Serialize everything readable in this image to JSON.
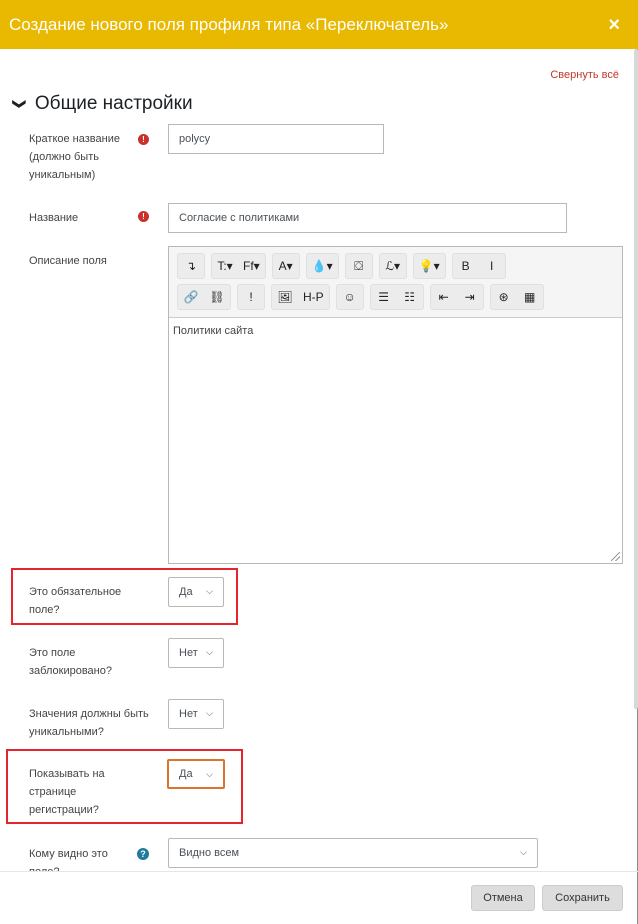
{
  "header": {
    "title": "Создание нового поля профиля типа «Переключатель»",
    "close_glyph": "×",
    "color": "#e8b900"
  },
  "collapse_all": "Свернуть всё",
  "section": {
    "chevron": "❯",
    "title": "Общие настройки"
  },
  "fields": {
    "shortname": {
      "label": "Краткое название (должно быть уникальным)",
      "value": "polycy",
      "required_icon": "!"
    },
    "name": {
      "label": "Название",
      "value": "Согласие с политиками",
      "required_icon": "!"
    },
    "description": {
      "label": "Описание поля",
      "content": "Политики сайта"
    },
    "required": {
      "label": "Это обязательное поле?",
      "value": "Да"
    },
    "locked": {
      "label": "Это поле заблокировано?",
      "value": "Нет"
    },
    "unique": {
      "label": "Значения должны быть уникальными?",
      "value": "Нет"
    },
    "signup": {
      "label": "Показывать на странице регистрации?",
      "value": "Да"
    },
    "visible": {
      "label": "Кому видно это поле?",
      "value": "Видно всем",
      "help_icon": "?"
    }
  },
  "toolbar": {
    "row1": [
      [
        "↴"
      ],
      [
        "T:▾",
        "Ff▾"
      ],
      [
        "A▾"
      ],
      [
        "💧▾"
      ],
      [
        "⛋"
      ],
      [
        "ℒ▾"
      ],
      [
        "💡▾"
      ],
      [
        "B",
        "I"
      ]
    ],
    "row2": [
      [
        "🔗",
        "⛓"
      ],
      [
        "!"
      ],
      [
        "🖼",
        "H-P"
      ],
      [
        "☺"
      ],
      [
        "☰",
        "☷"
      ],
      [
        "⇤",
        "⇥"
      ],
      [
        "⊛",
        "▦"
      ]
    ]
  },
  "buttons": {
    "cancel": "Отмена",
    "save": "Сохранить"
  },
  "colors": {
    "link": "#c0392b",
    "required": "#c9302c",
    "help": "#1f7a9c",
    "highlight_red": "#e3262d",
    "highlight_orange": "#d9742e"
  }
}
